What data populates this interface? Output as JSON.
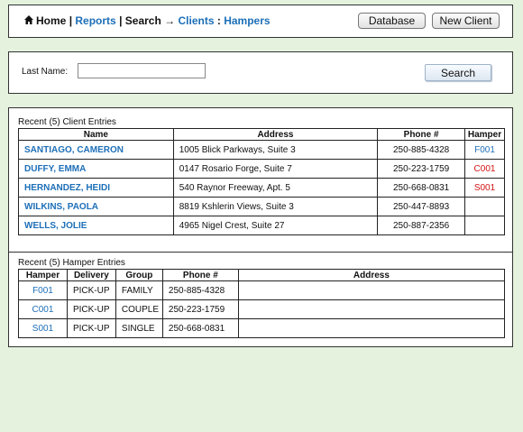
{
  "nav": {
    "home": "Home",
    "sep1": "|",
    "reports": "Reports",
    "sep2": "|",
    "search": "Search",
    "arrow": "→",
    "clients": "Clients",
    "colon": ":",
    "hampers": "Hampers",
    "database_button": "Database",
    "new_client_button": "New Client"
  },
  "search": {
    "last_name_label": "Last Name:",
    "last_name_value": "",
    "search_button": "Search"
  },
  "client_entries": {
    "title": "Recent (5) Client Entries",
    "headers": [
      "Name",
      "Address",
      "Phone #",
      "Hamper"
    ],
    "rows": [
      {
        "name": "SANTIAGO, CAMERON",
        "address": "1005 Blick Parkways, Suite 3",
        "phone": "250-885-4328",
        "hamper": "F001",
        "hamper_color": "#1d6fb8"
      },
      {
        "name": "DUFFY, EMMA",
        "address": "0147 Rosario Forge, Suite 7",
        "phone": "250-223-1759",
        "hamper": "C001",
        "hamper_color": "#d41414"
      },
      {
        "name": "HERNANDEZ, HEIDI",
        "address": "540 Raynor Freeway, Apt. 5",
        "phone": "250-668-0831",
        "hamper": "S001",
        "hamper_color": "#d41414"
      },
      {
        "name": "WILKINS, PAOLA",
        "address": "8819 Kshlerin Views, Suite 3",
        "phone": "250-447-8893",
        "hamper": "",
        "hamper_color": ""
      },
      {
        "name": "WELLS, JOLIE",
        "address": "4965 Nigel Crest, Suite 27",
        "phone": "250-887-2356",
        "hamper": "",
        "hamper_color": ""
      }
    ]
  },
  "hamper_entries": {
    "title": "Recent (5) Hamper Entries",
    "headers": [
      "Hamper",
      "Delivery",
      "Group",
      "Phone #",
      "Address"
    ],
    "rows": [
      {
        "hamper": "F001",
        "delivery": "PICK-UP",
        "group": "FAMILY",
        "phone": "250-885-4328",
        "address": ""
      },
      {
        "hamper": "C001",
        "delivery": "PICK-UP",
        "group": "COUPLE",
        "phone": "250-223-1759",
        "address": ""
      },
      {
        "hamper": "S001",
        "delivery": "PICK-UP",
        "group": "SINGLE",
        "phone": "250-668-0831",
        "address": ""
      }
    ]
  },
  "colors": {
    "link": "#1d6fb8",
    "alert": "#d41414",
    "page_background": "#e4f2de"
  },
  "icons": {
    "home": "home-icon"
  }
}
